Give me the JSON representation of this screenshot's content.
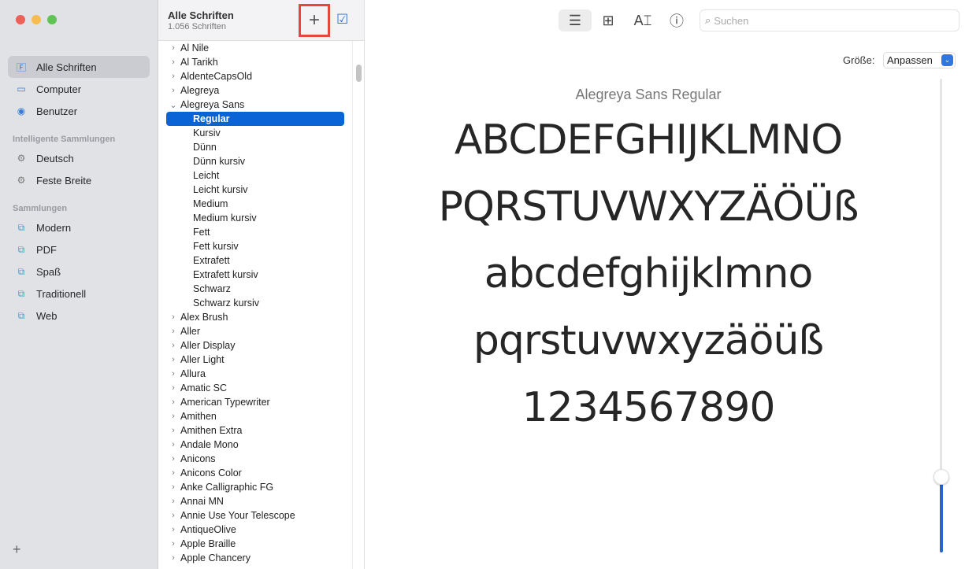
{
  "sidebar": {
    "items": [
      {
        "label": "Alle Schriften",
        "icon": "font-book-icon",
        "selected": true
      },
      {
        "label": "Computer",
        "icon": "laptop-icon"
      },
      {
        "label": "Benutzer",
        "icon": "user-icon"
      }
    ],
    "smart_header": "Intelligente Sammlungen",
    "smart": [
      {
        "label": "Deutsch",
        "icon": "gear-icon"
      },
      {
        "label": "Feste Breite",
        "icon": "gear-icon"
      }
    ],
    "collections_header": "Sammlungen",
    "collections": [
      {
        "label": "Modern"
      },
      {
        "label": "PDF"
      },
      {
        "label": "Spaß"
      },
      {
        "label": "Traditionell"
      },
      {
        "label": "Web"
      }
    ],
    "add_label": "+"
  },
  "list": {
    "title": "Alle Schriften",
    "count": "1.056 Schriften",
    "add_label": "+",
    "check_label": "☑",
    "rows": [
      {
        "label": "Al Nile",
        "level": 0
      },
      {
        "label": "Al Tarikh",
        "level": 0
      },
      {
        "label": "AldenteCapsOld",
        "level": 0
      },
      {
        "label": "Alegreya",
        "level": 0
      },
      {
        "label": "Alegreya Sans",
        "level": 0,
        "expanded": true
      },
      {
        "label": "Regular",
        "level": 1,
        "selected": true
      },
      {
        "label": "Kursiv",
        "level": 1
      },
      {
        "label": "Dünn",
        "level": 1
      },
      {
        "label": "Dünn kursiv",
        "level": 1
      },
      {
        "label": "Leicht",
        "level": 1
      },
      {
        "label": "Leicht kursiv",
        "level": 1
      },
      {
        "label": "Medium",
        "level": 1
      },
      {
        "label": "Medium kursiv",
        "level": 1
      },
      {
        "label": "Fett",
        "level": 1
      },
      {
        "label": "Fett kursiv",
        "level": 1
      },
      {
        "label": "Extrafett",
        "level": 1
      },
      {
        "label": "Extrafett kursiv",
        "level": 1
      },
      {
        "label": "Schwarz",
        "level": 1
      },
      {
        "label": "Schwarz kursiv",
        "level": 1
      },
      {
        "label": "Alex Brush",
        "level": 0
      },
      {
        "label": "Aller",
        "level": 0
      },
      {
        "label": "Aller Display",
        "level": 0
      },
      {
        "label": "Aller Light",
        "level": 0
      },
      {
        "label": "Allura",
        "level": 0
      },
      {
        "label": "Amatic SC",
        "level": 0
      },
      {
        "label": "American Typewriter",
        "level": 0
      },
      {
        "label": "Amithen",
        "level": 0
      },
      {
        "label": "Amithen Extra",
        "level": 0
      },
      {
        "label": "Andale Mono",
        "level": 0
      },
      {
        "label": "Anicons",
        "level": 0
      },
      {
        "label": "Anicons Color",
        "level": 0
      },
      {
        "label": "Anke Calligraphic FG",
        "level": 0
      },
      {
        "label": "Annai MN",
        "level": 0
      },
      {
        "label": "Annie Use Your Telescope",
        "level": 0
      },
      {
        "label": "AntiqueOlive",
        "level": 0
      },
      {
        "label": "Apple Braille",
        "level": 0
      },
      {
        "label": "Apple Chancery",
        "level": 0
      }
    ]
  },
  "toolbar": {
    "search_placeholder": "Suchen",
    "size_label": "Größe:",
    "size_value": "Anpassen"
  },
  "preview": {
    "font_name": "Alegreya Sans Regular",
    "lines": [
      "ABCDEFGHIJKLMNO",
      "PQRSTUVWXYZÄÖÜß",
      "abcdefghijklmno",
      "pqrstuvwxyzäöüß",
      "1234567890"
    ],
    "size_slider_fraction": 0.16
  },
  "colors": {
    "accent": "#0a64d6",
    "highlight_box": "#e5473a"
  }
}
